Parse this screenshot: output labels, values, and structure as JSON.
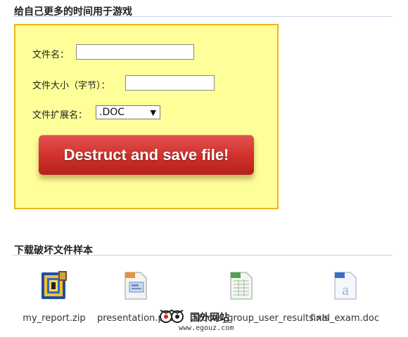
{
  "section1": {
    "title": "给自己更多的时间用于游戏"
  },
  "form": {
    "filename_label": "文件名：",
    "filename_value": "",
    "filesize_label": "文件大小（字节）：",
    "filesize_value": "",
    "ext_label": "文件扩展名：",
    "ext_selected": ".DOC",
    "submit_label": "Destruct and save file!"
  },
  "section2": {
    "title": "下载破坏文件样本"
  },
  "samples": [
    {
      "name": "my_report.zip",
      "icon": "zip-archive-icon"
    },
    {
      "name": "presentation.ppt",
      "icon": "presentation-file-icon"
    },
    {
      "name": "focus_group_user_results.xls",
      "icon": "spreadsheet-file-icon"
    },
    {
      "name": "final_exam.doc",
      "icon": "document-file-icon"
    }
  ],
  "watermark": {
    "text": "国外网站",
    "url": "www.egouz.com"
  },
  "colors": {
    "panel_bg": "#ffff99",
    "panel_border": "#f0b418",
    "button_red": "#d2322d"
  }
}
